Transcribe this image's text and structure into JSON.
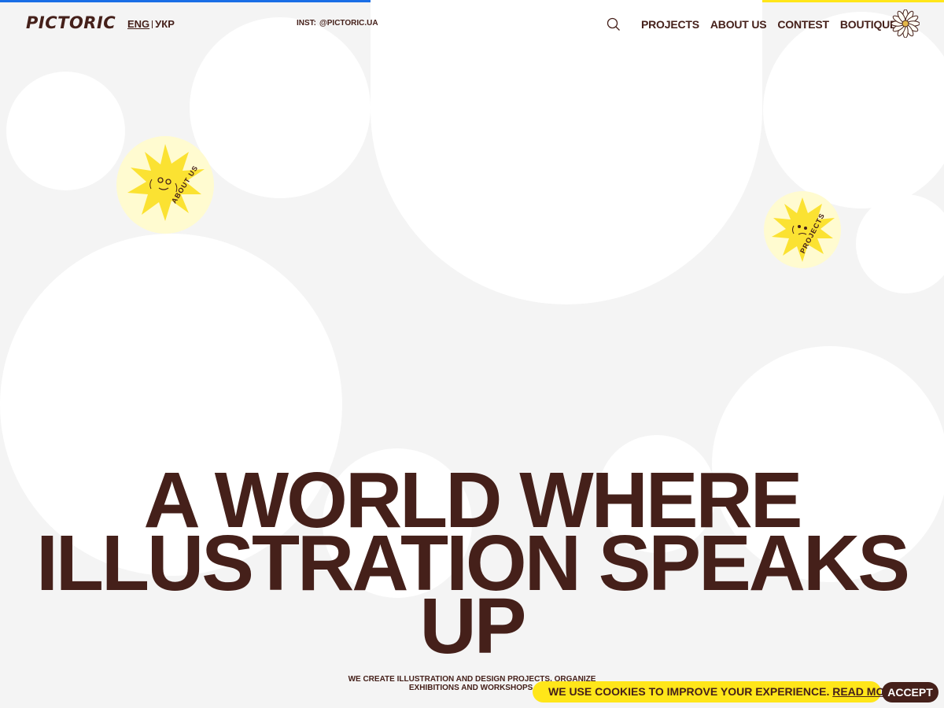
{
  "brand": {
    "logo_text": "PICTORIC"
  },
  "language": {
    "active": "ENG",
    "other": "УКР"
  },
  "instagram": {
    "label": "INST:",
    "handle": "@PICTORIC.UA"
  },
  "nav": {
    "items": [
      "PROJECTS",
      "ABOUT US",
      "CONTEST",
      "BOUTIQUE"
    ]
  },
  "icons": {
    "search": "search-icon",
    "menu_flower": "flower-icon",
    "sticker": "sun-face-icon"
  },
  "stickers": {
    "about_label": "ABOUT US",
    "projects_label": "PROJECTS"
  },
  "hero": {
    "line1": "A WORLD WHERE",
    "line2": "ILLUSTRATION SPEAKS",
    "line3": "UP"
  },
  "subtitle": {
    "line1": "WE CREATE ILLUSTRATION AND DESIGN PROJECTS, ORGANIZE",
    "line2": "EXHIBITIONS AND WORKSHOPS."
  },
  "cookie": {
    "text": "WE USE COOKIES TO IMPROVE YOUR EXPERIENCE.",
    "read_more": "READ MORE",
    "accept": "ACCEPT"
  },
  "colors": {
    "text": "#45201a",
    "accent_yellow": "#ffe619",
    "accent_blue": "#1a6ee6",
    "background": "#f4f4f4"
  }
}
